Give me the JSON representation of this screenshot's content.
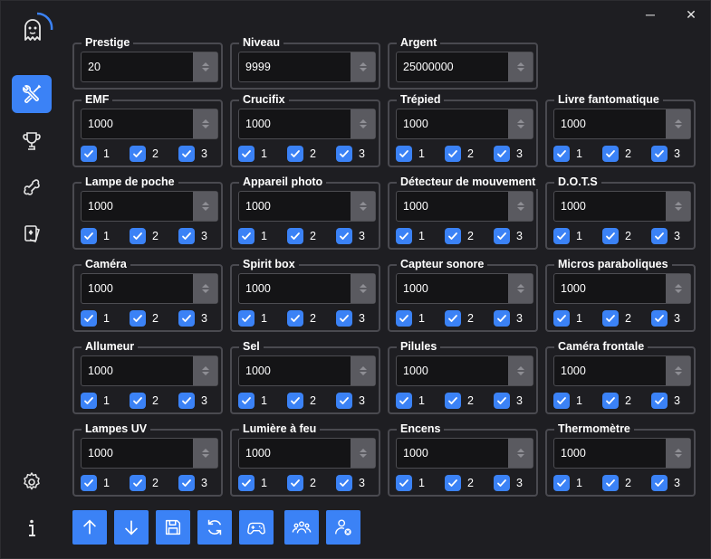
{
  "window": {
    "minimize_glyph": "─",
    "close_glyph": "✕"
  },
  "sidebar": {
    "logo_icon": "ghost-logo-icon",
    "items": [
      {
        "id": "tools",
        "icon": "tools-icon",
        "active": true
      },
      {
        "id": "trophy",
        "icon": "trophy-icon",
        "active": false
      },
      {
        "id": "bone",
        "icon": "bone-icon",
        "active": false
      },
      {
        "id": "cards",
        "icon": "cards-icon",
        "active": false
      }
    ],
    "settings_icon": "gear-icon",
    "info_icon": "info-icon"
  },
  "stats": {
    "prestige": {
      "label": "Prestige",
      "value": "20"
    },
    "niveau": {
      "label": "Niveau",
      "value": "9999"
    },
    "argent": {
      "label": "Argent",
      "value": "25000000"
    }
  },
  "check_labels": [
    "1",
    "2",
    "3"
  ],
  "equipment": [
    {
      "label": "EMF",
      "value": "1000"
    },
    {
      "label": "Crucifix",
      "value": "1000"
    },
    {
      "label": "Trépied",
      "value": "1000"
    },
    {
      "label": "Livre fantomatique",
      "value": "1000"
    },
    {
      "label": "Lampe de poche",
      "value": "1000"
    },
    {
      "label": "Appareil photo",
      "value": "1000"
    },
    {
      "label": "Détecteur de mouvement",
      "value": "1000"
    },
    {
      "label": "D.O.T.S",
      "value": "1000"
    },
    {
      "label": "Caméra",
      "value": "1000"
    },
    {
      "label": "Spirit box",
      "value": "1000"
    },
    {
      "label": "Capteur sonore",
      "value": "1000"
    },
    {
      "label": "Micros paraboliques",
      "value": "1000"
    },
    {
      "label": "Allumeur",
      "value": "1000"
    },
    {
      "label": "Sel",
      "value": "1000"
    },
    {
      "label": "Pilules",
      "value": "1000"
    },
    {
      "label": "Caméra frontale",
      "value": "1000"
    },
    {
      "label": "Lampes UV",
      "value": "1000"
    },
    {
      "label": "Lumière à feu",
      "value": "1000"
    },
    {
      "label": "Encens",
      "value": "1000"
    },
    {
      "label": "Thermomètre",
      "value": "1000"
    }
  ],
  "toolbar": [
    {
      "id": "upload",
      "icon": "arrow-up-icon"
    },
    {
      "id": "download",
      "icon": "arrow-down-icon"
    },
    {
      "id": "save",
      "icon": "save-icon"
    },
    {
      "id": "refresh",
      "icon": "refresh-icon"
    },
    {
      "id": "gamepad",
      "icon": "gamepad-icon"
    },
    {
      "id": "group",
      "icon": "users-icon"
    },
    {
      "id": "remove-user",
      "icon": "user-remove-icon"
    }
  ],
  "colors": {
    "accent": "#3b82f6",
    "background": "#1e1e22",
    "border": "#4a4a50"
  }
}
